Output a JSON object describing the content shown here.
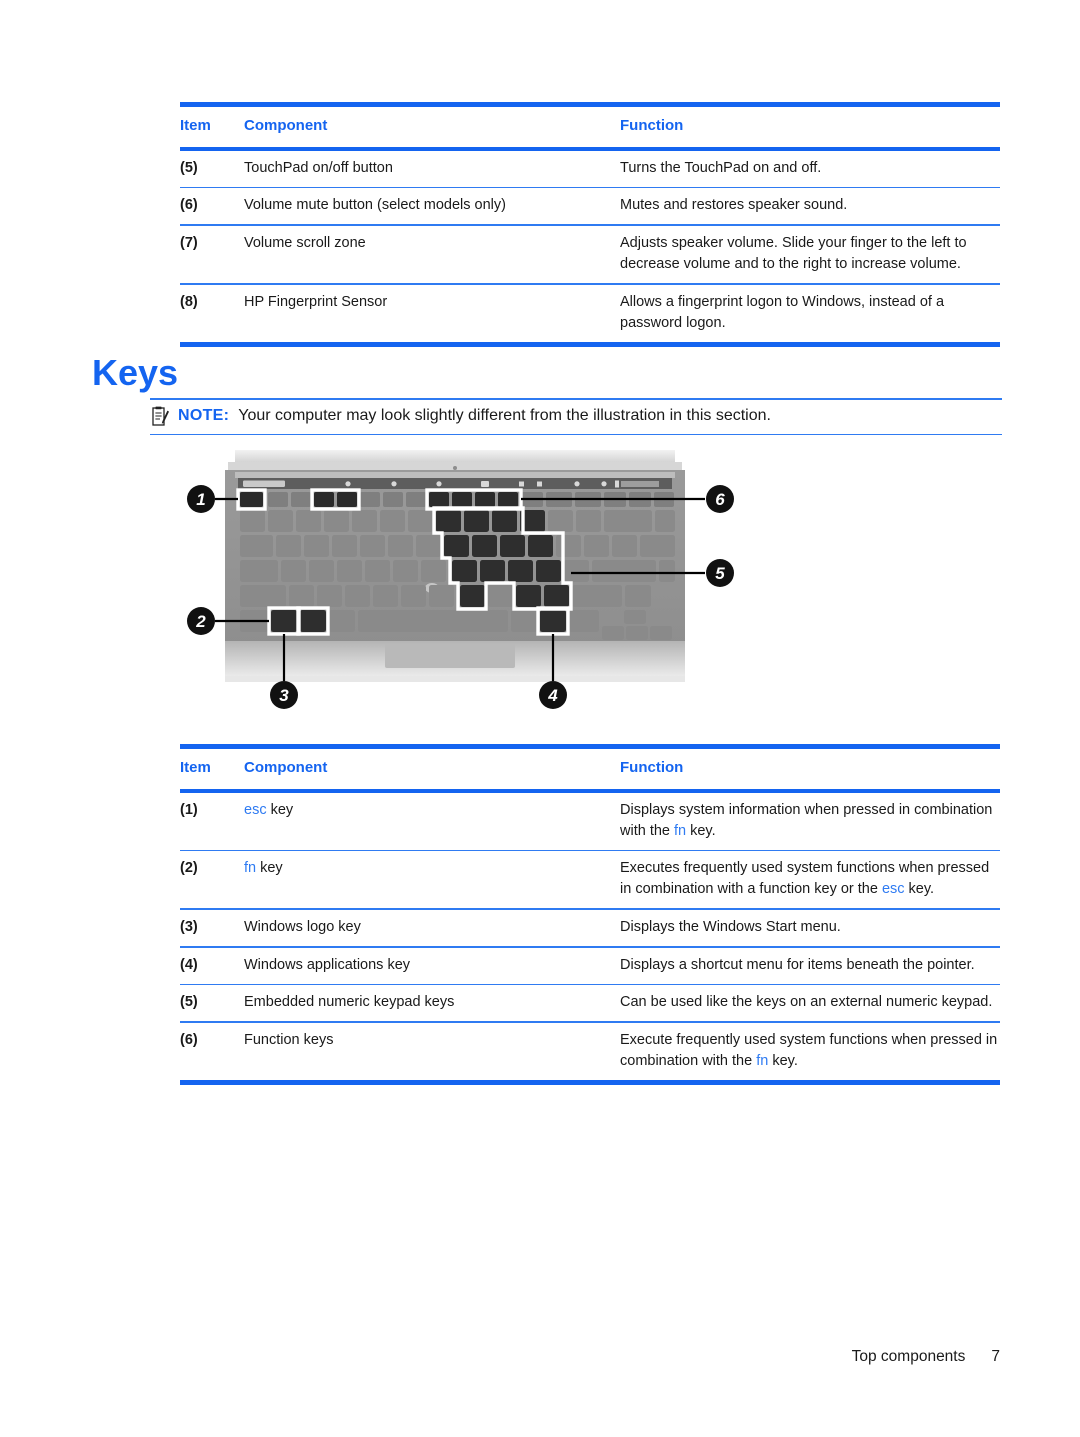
{
  "heading": "Keys",
  "note": {
    "icon": "note-clipboard-icon",
    "label": "NOTE:",
    "text": "Your computer may look slightly different from the illustration in this section."
  },
  "table_top": {
    "headers": {
      "item": "Item",
      "component": "Component",
      "function": "Function"
    },
    "rows": [
      {
        "item": "(5)",
        "component": "TouchPad on/off button",
        "function": "Turns the TouchPad on and off."
      },
      {
        "item": "(6)",
        "component": "Volume mute button (select models only)",
        "function": "Mutes and restores speaker sound."
      },
      {
        "item": "(7)",
        "component": "Volume scroll zone",
        "function": "Adjusts speaker volume. Slide your finger to the left to decrease volume and to the right to increase volume."
      },
      {
        "item": "(8)",
        "component": "HP Fingerprint Sensor",
        "function": "Allows a fingerprint logon to Windows, instead of a password logon."
      }
    ]
  },
  "table_bottom": {
    "headers": {
      "item": "Item",
      "component": "Component",
      "function": "Function"
    },
    "rows": [
      {
        "item": "(1)",
        "component_pre": "",
        "component_kw": "esc",
        "component_post": " key",
        "function_parts": [
          "Displays system information when pressed in combination with the ",
          "fn",
          " key."
        ]
      },
      {
        "item": "(2)",
        "component_pre": "",
        "component_kw": "fn",
        "component_post": " key",
        "function_parts": [
          "Executes frequently used system functions when pressed in combination with a function key or the ",
          "esc",
          " key."
        ]
      },
      {
        "item": "(3)",
        "component_pre": "Windows logo key",
        "component_kw": "",
        "component_post": "",
        "function_parts": [
          "Displays the Windows Start menu.",
          "",
          ""
        ]
      },
      {
        "item": "(4)",
        "component_pre": "Windows applications key",
        "component_kw": "",
        "component_post": "",
        "function_parts": [
          "Displays a shortcut menu for items beneath the pointer.",
          "",
          ""
        ]
      },
      {
        "item": "(5)",
        "component_pre": "Embedded numeric keypad keys",
        "component_kw": "",
        "component_post": "",
        "function_parts": [
          "Can be used like the keys on an external numeric keypad.",
          "",
          ""
        ]
      },
      {
        "item": "(6)",
        "component_pre": "Function keys",
        "component_kw": "",
        "component_post": "",
        "function_parts": [
          "Execute frequently used system functions when pressed in combination with the ",
          "fn",
          " key."
        ]
      }
    ]
  },
  "illustration": {
    "alt": "laptop-keyboard-diagram",
    "callouts": [
      "1",
      "2",
      "3",
      "4",
      "5",
      "6"
    ]
  },
  "footer": {
    "section": "Top components",
    "page": "7"
  },
  "colors": {
    "accent_blue": "#1464f0",
    "rule_blue": "#2f7bf2",
    "text": "#1a1a1a"
  }
}
